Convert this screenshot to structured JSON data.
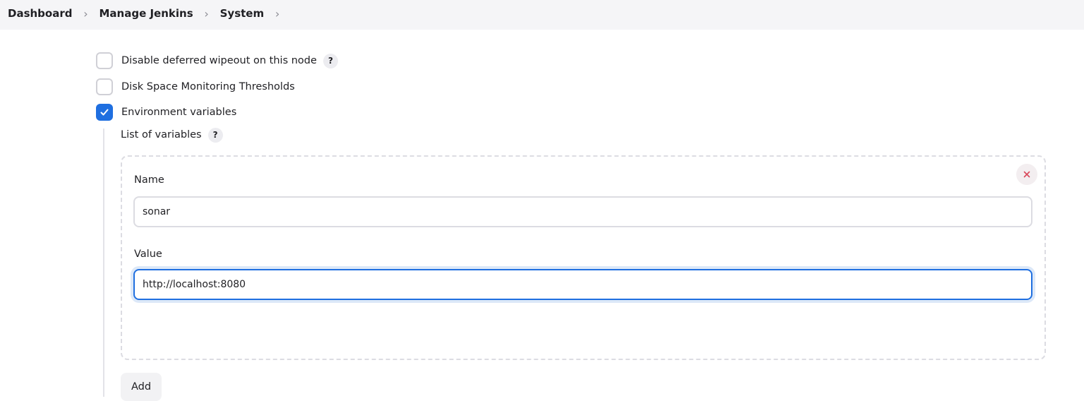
{
  "breadcrumb": {
    "items": [
      "Dashboard",
      "Manage Jenkins",
      "System"
    ],
    "separator": "›"
  },
  "options": {
    "deferred_wipeout": {
      "label": "Disable deferred wipeout on this node",
      "checked": false
    },
    "disk_space": {
      "label": "Disk Space Monitoring Thresholds",
      "checked": false
    },
    "env_vars": {
      "label": "Environment variables",
      "checked": true
    }
  },
  "env_vars": {
    "list_label": "List of variables",
    "entry": {
      "name_label": "Name",
      "name_value": "sonar",
      "value_label": "Value",
      "value_value": "http://localhost:8080"
    },
    "add_label": "Add"
  },
  "help_icon_text": "?",
  "icons": {
    "help": "question-mark-icon",
    "delete": "close-icon",
    "check": "checkmark-icon",
    "chevron": "chevron-right-icon"
  },
  "colors": {
    "accent": "#1f6fe0",
    "danger": "#d9485a",
    "topbar": "#f5f5f7"
  }
}
